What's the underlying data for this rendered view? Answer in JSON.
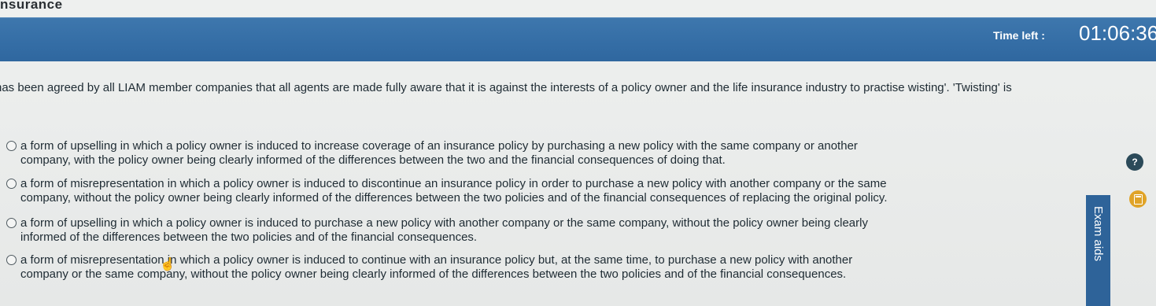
{
  "app": {
    "title": "nsurance"
  },
  "header": {
    "time_left_label": "Time left :",
    "time_left_value": "01:06:36"
  },
  "question": {
    "text": "has been agreed by all LIAM member companies that all agents are made fully aware that it is against the interests of a policy owner and the life insurance industry to practise wisting'. 'Twisting' is"
  },
  "options": [
    {
      "line1": "a form of upselling in which a policy owner is induced to increase coverage of an insurance policy by purchasing a new policy with the same company or another",
      "line2": "company, with the policy owner being clearly informed of the differences between the two and the financial consequences of doing that.",
      "selected": false
    },
    {
      "line1": "a form of misrepresentation in which a policy owner is induced to discontinue an insurance policy in order to purchase a new policy with another company or the same",
      "line2": "company, without the policy owner being clearly informed of the differences between the two policies and of the financial consequences of replacing the original policy.",
      "selected": false
    },
    {
      "line1": "a form of upselling in which a policy owner is induced to purchase a new policy with another company or the same company, without the policy owner being clearly",
      "line2": "informed of the differences between the two policies and of the financial consequences.",
      "selected": false
    },
    {
      "line1": "a form of misrepresentation in which a policy owner is induced to continue with an insurance policy but, at the same time, to purchase a new policy with another",
      "line2": "company or the same company, without the policy owner being clearly informed of the differences between the two policies and of the financial consequences.",
      "selected": false
    }
  ],
  "sidebar": {
    "exam_aids_label": "Exam aids",
    "help_icon": "question-icon",
    "calculator_icon": "calculator-icon"
  },
  "colors": {
    "header_blue": "#356ea6",
    "sidebar_blue": "#2e6399",
    "calculator_orange": "#e0a327",
    "help_dark": "#2b4a59"
  }
}
